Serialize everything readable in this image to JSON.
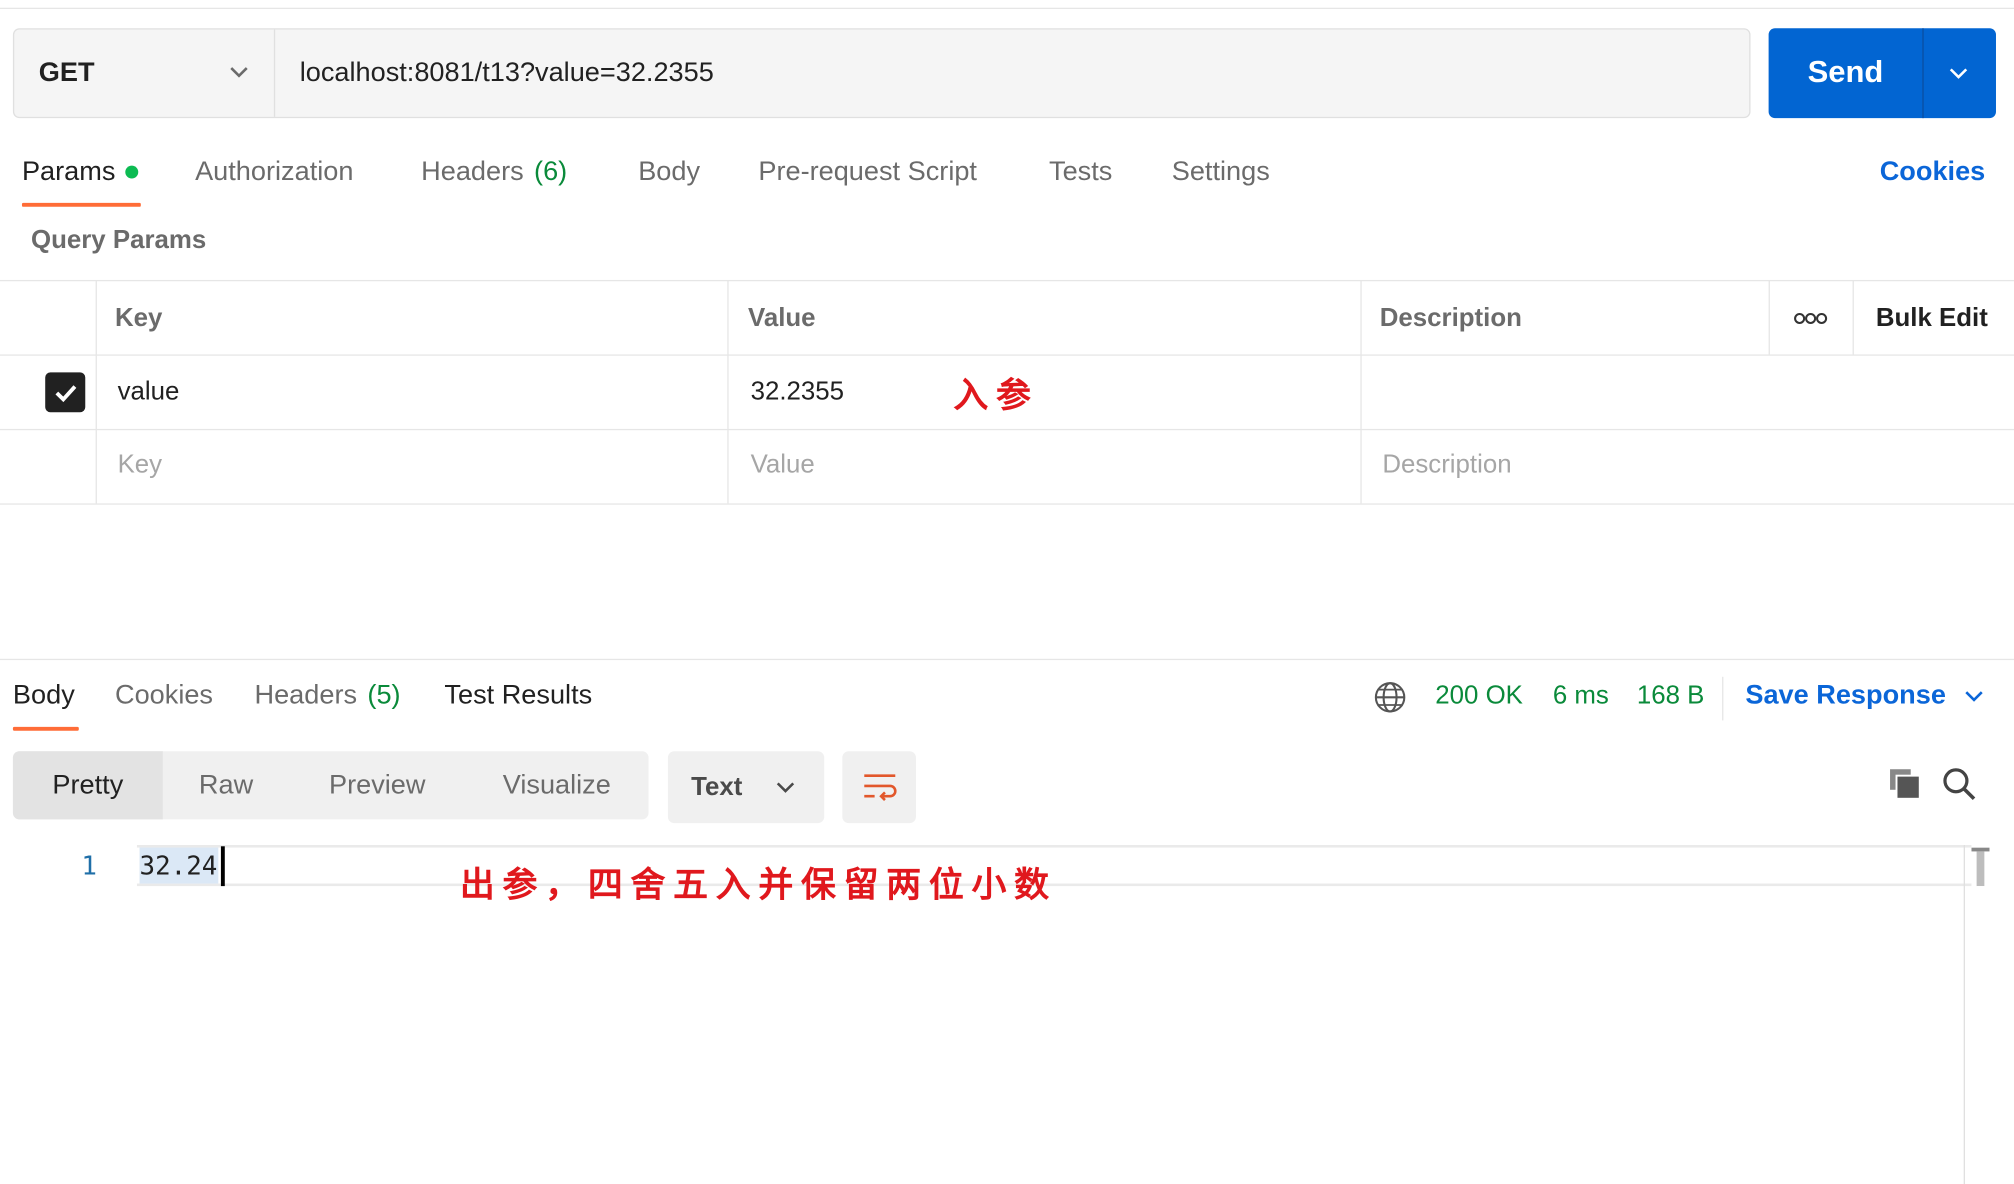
{
  "request": {
    "method": "GET",
    "url": "localhost:8081/t13?value=32.2355",
    "send_label": "Send"
  },
  "request_tabs": {
    "params": "Params",
    "authorization": "Authorization",
    "headers": "Headers",
    "headers_count": "(6)",
    "body": "Body",
    "pre_request": "Pre-request Script",
    "tests": "Tests",
    "settings": "Settings",
    "cookies": "Cookies"
  },
  "query_params": {
    "title": "Query Params",
    "columns": {
      "key": "Key",
      "value": "Value",
      "description": "Description",
      "bulk_edit": "Bulk Edit"
    },
    "rows": [
      {
        "checked": true,
        "key": "value",
        "value": "32.2355",
        "description": ""
      }
    ],
    "placeholder": {
      "key": "Key",
      "value": "Value",
      "description": "Description"
    }
  },
  "annotations": {
    "input_note": "入参",
    "output_note": "出参，四舍五入并保留两位小数"
  },
  "response": {
    "tabs": {
      "body": "Body",
      "cookies": "Cookies",
      "headers": "Headers",
      "headers_count": "(5)",
      "test_results": "Test Results"
    },
    "status": "200 OK",
    "time": "6 ms",
    "size": "168 B",
    "save_response": "Save Response",
    "view_modes": [
      "Pretty",
      "Raw",
      "Preview",
      "Visualize"
    ],
    "format": "Text",
    "lines": [
      {
        "number": "1",
        "text": "32.24"
      }
    ]
  },
  "colors": {
    "accent": "#ff6c37",
    "send": "#0265d2",
    "link": "#0b66d8",
    "status_ok": "#0a8a3a",
    "annotation": "#e0181d"
  },
  "icons": [
    "chevron-down-icon",
    "checkbox-checked-icon",
    "more-options-icon",
    "globe-icon",
    "wrap-lines-icon",
    "copy-icon",
    "search-icon"
  ]
}
